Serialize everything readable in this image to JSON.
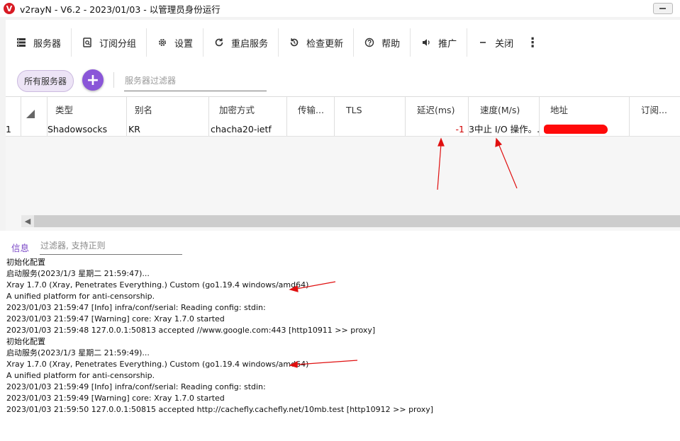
{
  "window": {
    "title": "v2rayN - V6.2 - 2023/01/03 - 以管理员身份运行",
    "logo_glyph": "V"
  },
  "toolbar": {
    "items": [
      {
        "label": "服务器",
        "icon": "server-icon"
      },
      {
        "label": "订阅分组",
        "icon": "subscription-icon"
      },
      {
        "label": "设置",
        "icon": "gear-icon"
      },
      {
        "label": "重启服务",
        "icon": "refresh-icon"
      },
      {
        "label": "检查更新",
        "icon": "update-icon"
      },
      {
        "label": "帮助",
        "icon": "help-icon"
      },
      {
        "label": "推广",
        "icon": "speaker-icon"
      },
      {
        "label": "关闭",
        "icon": "minus-icon"
      }
    ],
    "more_glyph": "⋮"
  },
  "filter_bar": {
    "all_servers_label": "所有服务器",
    "add_glyph": "+",
    "filter_placeholder": "服务器过滤器"
  },
  "server_grid": {
    "columns": [
      "类型",
      "别名",
      "加密方式",
      "传输...",
      "TLS",
      "延迟(ms)",
      "速度(M/s)",
      "地址",
      "订阅..."
    ],
    "rows": [
      {
        "index": "1",
        "type": "Shadowsocks",
        "alias": "KR",
        "security": "chacha20-ietf",
        "transport": "",
        "tls": "",
        "latency": "-1",
        "speed": "3中止 I/O 操作。.",
        "address": "",
        "subscription": ""
      }
    ]
  },
  "log_panel": {
    "tab_label": "信息",
    "filter_placeholder": "过滤器, 支持正则",
    "lines": [
      "初始化配置",
      "启动服务(2023/1/3 星期二 21:59:47)...",
      "Xray 1.7.0 (Xray, Penetrates Everything.) Custom (go1.19.4 windows/amd64)",
      "A unified platform for anti-censorship.",
      "2023/01/03 21:59:47 [Info] infra/conf/serial: Reading config: stdin:",
      "2023/01/03 21:59:47 [Warning] core: Xray 1.7.0 started",
      "2023/01/03 21:59:48 127.0.0.1:50813 accepted //www.google.com:443 [http10911 >> proxy]",
      "初始化配置",
      "启动服务(2023/1/3 星期二 21:59:49)...",
      "Xray 1.7.0 (Xray, Penetrates Everything.) Custom (go1.19.4 windows/amd64)",
      "A unified platform for anti-censorship.",
      "2023/01/03 21:59:49 [Info] infra/conf/serial: Reading config: stdin:",
      "2023/01/03 21:59:49 [Warning] core: Xray 1.7.0 started",
      "2023/01/03 21:59:50 127.0.0.1:50815 accepted http://cachefly.cachefly.net/10mb.test [http10912 >> proxy]"
    ]
  },
  "colors": {
    "accent": "#8a56d8",
    "annotation_red": "#e01010",
    "latency_red": "#d00000"
  }
}
